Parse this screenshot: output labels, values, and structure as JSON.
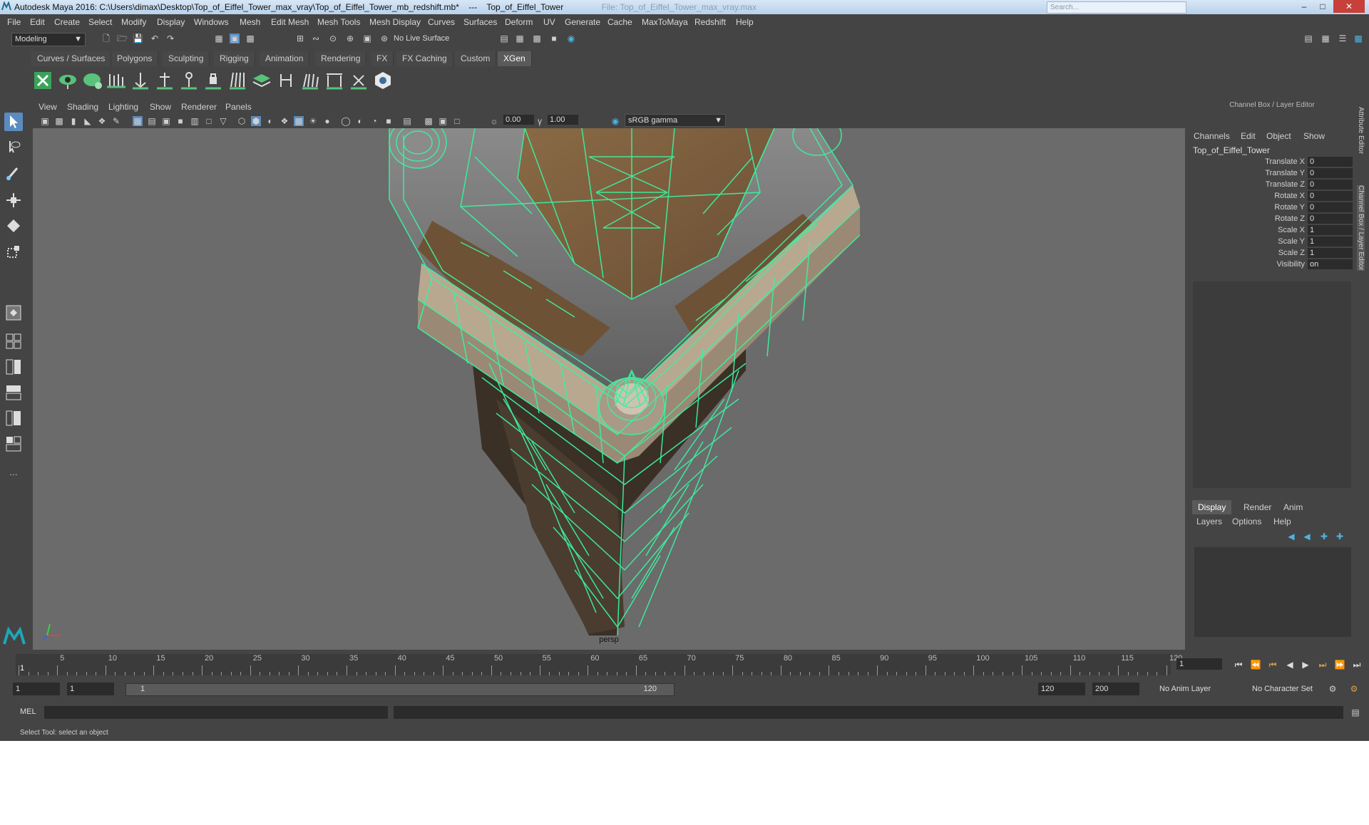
{
  "titlebar": {
    "app": "Autodesk Maya 2016: C:\\Users\\dimax\\Desktop\\Top_of_Eiffel_Tower_max_vray\\Top_of_Eiffel_Tower_mb_redshift.mb*",
    "sep": "---",
    "object": "Top_of_Eiffel_Tower",
    "ghost": "File: Top_of_Eiffel_Tower_max_vray.max"
  },
  "menubar": [
    "File",
    "Edit",
    "Create",
    "Select",
    "Modify",
    "Display",
    "Windows",
    "Mesh",
    "Edit Mesh",
    "Mesh Tools",
    "Mesh Display",
    "Curves",
    "Surfaces",
    "Deform",
    "UV",
    "Generate",
    "Cache",
    "MaxToMaya",
    "Redshift",
    "Help"
  ],
  "toolbar": {
    "mode": "Modeling",
    "live_surface": "No Live Surface"
  },
  "shelf_tabs": [
    "Curves / Surfaces",
    "Polygons",
    "Sculpting",
    "Rigging",
    "Animation",
    "Rendering",
    "FX",
    "FX Caching",
    "Custom",
    "XGen"
  ],
  "shelf_active": "XGen",
  "viewport": {
    "menus": [
      "View",
      "Shading",
      "Lighting",
      "Show",
      "Renderer",
      "Panels"
    ],
    "exposure": "0.00",
    "gamma": "1.00",
    "color_space": "sRGB gamma",
    "camera": "persp"
  },
  "channel_box": {
    "title": "Channel Box / Layer Editor",
    "menus": [
      "Channels",
      "Edit",
      "Object",
      "Show"
    ],
    "object": "Top_of_Eiffel_Tower",
    "attributes": [
      {
        "label": "Translate X",
        "value": "0"
      },
      {
        "label": "Translate Y",
        "value": "0"
      },
      {
        "label": "Translate Z",
        "value": "0"
      },
      {
        "label": "Rotate X",
        "value": "0"
      },
      {
        "label": "Rotate Y",
        "value": "0"
      },
      {
        "label": "Rotate Z",
        "value": "0"
      },
      {
        "label": "Scale X",
        "value": "1"
      },
      {
        "label": "Scale Y",
        "value": "1"
      },
      {
        "label": "Scale Z",
        "value": "1"
      },
      {
        "label": "Visibility",
        "value": "on"
      }
    ],
    "layer_tabs": [
      "Display",
      "Render",
      "Anim"
    ],
    "layer_menus": [
      "Layers",
      "Options",
      "Help"
    ]
  },
  "side_tabs": [
    "Attribute Editor",
    "Channel Box / Layer Editor"
  ],
  "timeline": {
    "ticks": [
      "1",
      "5",
      "10",
      "15",
      "20",
      "25",
      "30",
      "35",
      "40",
      "45",
      "50",
      "55",
      "60",
      "65",
      "70",
      "75",
      "80",
      "85",
      "90",
      "95",
      "100",
      "105",
      "110",
      "115",
      "120"
    ],
    "current_frame": "1"
  },
  "range": {
    "start": "1",
    "playback_start": "1",
    "slider_start": "1",
    "slider_end": "120",
    "playback_end": "120",
    "end": "200",
    "anim_layer": "No Anim Layer",
    "character_set": "No Character Set"
  },
  "command": {
    "label": "MEL"
  },
  "help_line": "Select Tool: select an object",
  "colors": {
    "wire": "#3cf0a0",
    "bg": "#444444",
    "viewport": "#6b6b6b",
    "accent": "#5b8cbf"
  }
}
